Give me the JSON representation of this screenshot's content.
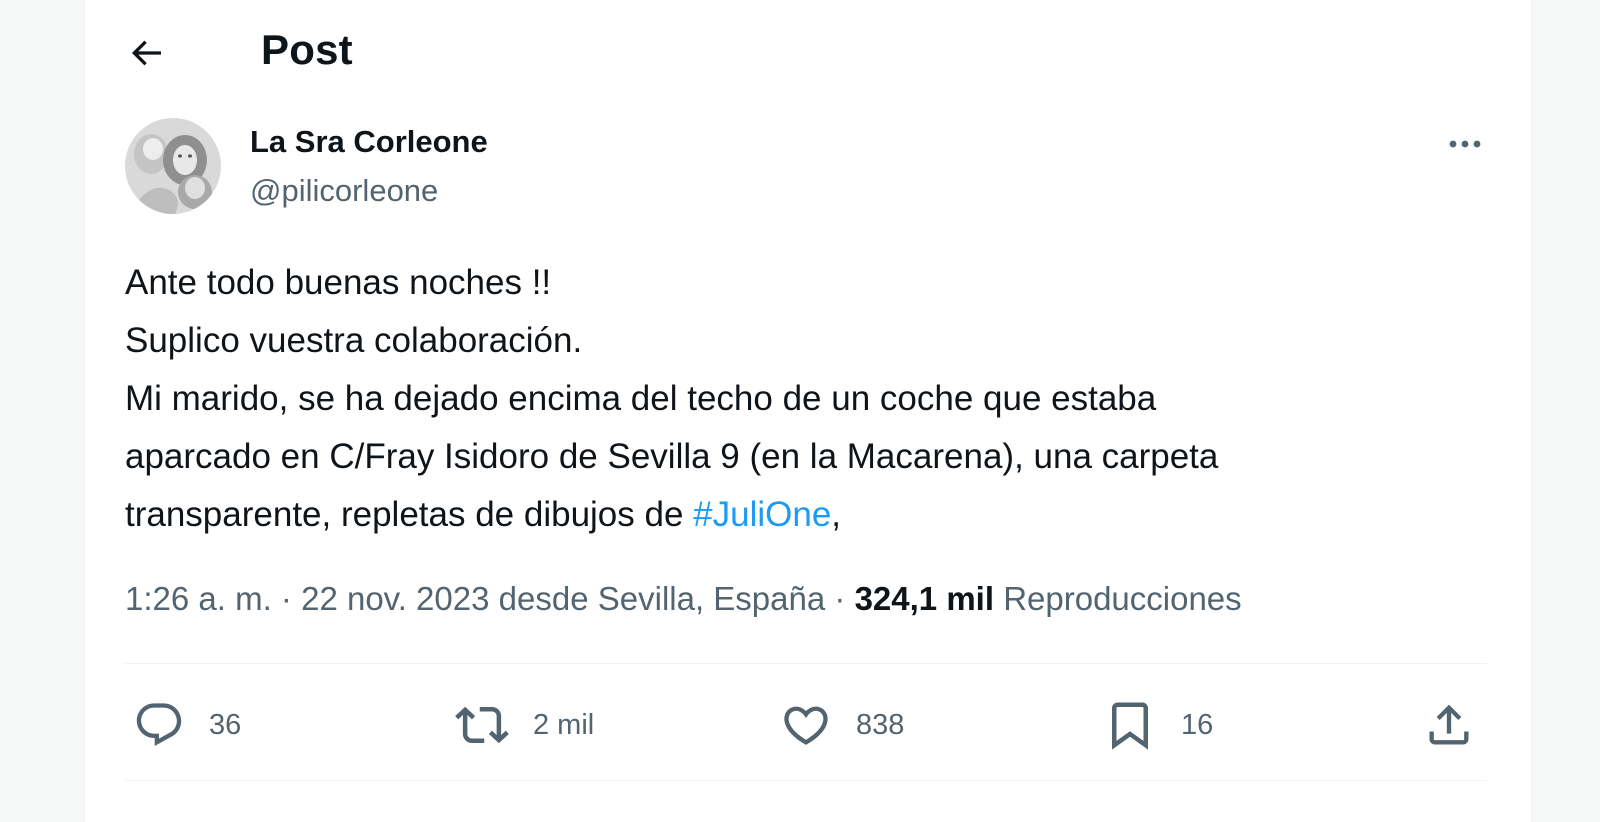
{
  "header": {
    "title": "Post"
  },
  "author": {
    "display_name": "La Sra Corleone",
    "handle": "@pilicorleone"
  },
  "tweet": {
    "lines": [
      "Ante todo buenas noches !!",
      "Suplico vuestra colaboración.",
      "Mi marido, se ha dejado encima del techo de un coche que estaba",
      "aparcado en C/Fray Isidoro de Sevilla 9 (en la Macarena), una carpeta",
      "transparente, repletas de dibujos de "
    ],
    "hashtag": "#JuliOne",
    "trailing": ","
  },
  "meta": {
    "time": "1:26 a. m.",
    "separator": "·",
    "date": "22 nov. 2023",
    "location_prefix": "desde",
    "location": "Sevilla, España",
    "views_count": "324,1 mil",
    "views_label": "Reproducciones"
  },
  "actions": {
    "replies": "36",
    "reposts": "2 mil",
    "likes": "838",
    "bookmarks": "16"
  },
  "icons": {
    "back": "arrow-left-icon",
    "more": "more-horizontal-icon",
    "reply": "reply-icon",
    "repost": "repost-icon",
    "like": "heart-icon",
    "bookmark": "bookmark-icon",
    "share": "share-icon"
  },
  "colors": {
    "text": "#0f1419",
    "secondary": "#536471",
    "link": "#1d9bf0",
    "divider": "#eff3f4"
  }
}
